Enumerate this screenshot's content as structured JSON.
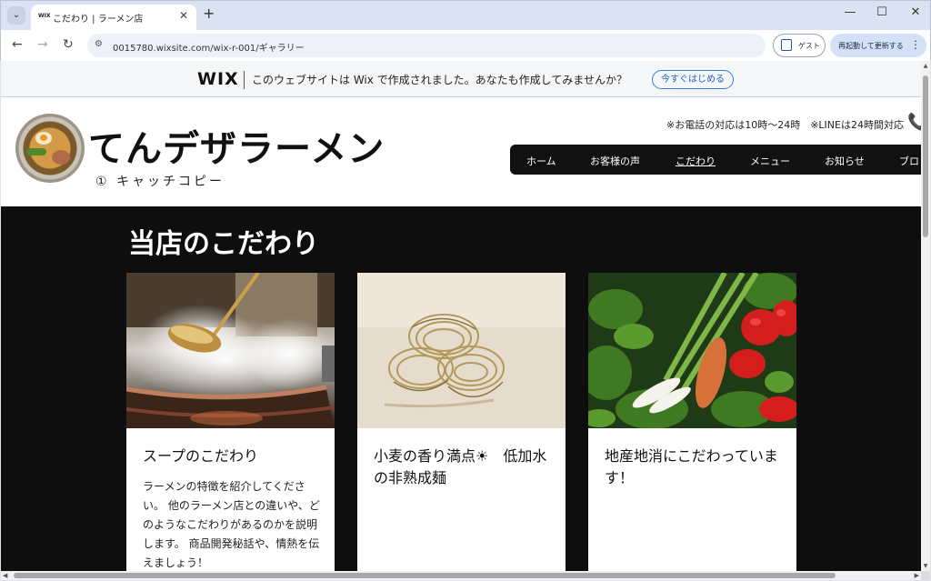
{
  "browser": {
    "tab_title": "こだわり | ラーメン店",
    "favicon_text": "WIX",
    "new_tab": "+",
    "tab_close": "✕",
    "url": "0015780.wixsite.com/wix-r-001/ギャラリー",
    "guest_label": "ゲスト",
    "restart_label": "再起動して更新する",
    "minimize": "—",
    "maximize": "☐",
    "close": "✕"
  },
  "wix_banner": {
    "logo": "WIX",
    "message": "このウェブサイトは Wix で作成されました。あなたも作成してみませんか？",
    "cta": "今すぐはじめる"
  },
  "site": {
    "title": "てんデザラーメン",
    "catch_copy": "① キャッチコピー",
    "contact": "※お電話の対応は10時〜24時　※LINEは24時間対応",
    "nav": [
      {
        "label": "ホーム"
      },
      {
        "label": "お客様の声"
      },
      {
        "label": "こだわり"
      },
      {
        "label": "メニュー"
      },
      {
        "label": "お知らせ"
      },
      {
        "label": "ブロ"
      }
    ]
  },
  "section": {
    "title": "当店のこだわり",
    "cards": [
      {
        "title": "スープのこだわり",
        "body": "ラーメンの特徴を紹介してください。 他のラーメン店との違いや、どのようなこだわりがあるのかを説明します。 商品開発秘話や、情熱を伝えましょう！"
      },
      {
        "title": "小麦の香り満点☀　低加水の非熟成麺",
        "body": ""
      },
      {
        "title": "地産地消にこだわっています！",
        "body": ""
      }
    ]
  },
  "colors": {
    "section_bg": "#0e0e0e",
    "nav_bg": "#111111",
    "accent_link": "#1a5fc8"
  }
}
